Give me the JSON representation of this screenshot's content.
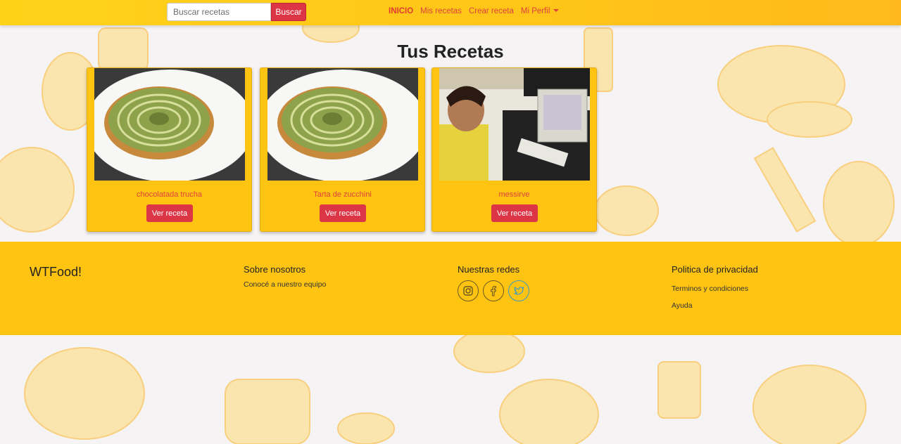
{
  "navbar": {
    "search_placeholder": "Buscar recetas",
    "search_button": "Buscar",
    "links": {
      "inicio": "INICIO",
      "mis_recetas": "Mis recetas",
      "crear_receta": "Crear receta",
      "mi_perfil": "Mi Perfil"
    }
  },
  "main": {
    "title": "Tus Recetas",
    "cards": [
      {
        "title": "chocolatada trucha",
        "button": "Ver receta",
        "image": "zucchini-tart-photo"
      },
      {
        "title": "Tarta de zucchini",
        "button": "Ver receta",
        "image": "zucchini-tart-photo"
      },
      {
        "title": "messirve",
        "button": "Ver receta",
        "image": "person-at-computer-photo"
      }
    ]
  },
  "footer": {
    "brand": "WTFood!",
    "about": {
      "heading": "Sobre nosotros",
      "link": "Conocé a nuestro equipo"
    },
    "social": {
      "heading": "Nuestras redes",
      "icons": [
        "instagram-icon",
        "facebook-icon",
        "twitter-icon"
      ]
    },
    "privacy": {
      "heading": "Politica de privacidad",
      "links": [
        "Terminos y condiciones",
        "Ayuda"
      ]
    }
  },
  "colors": {
    "accent_red": "#dc3545",
    "yellow": "#ffc412",
    "link_red": "#e0413c"
  }
}
